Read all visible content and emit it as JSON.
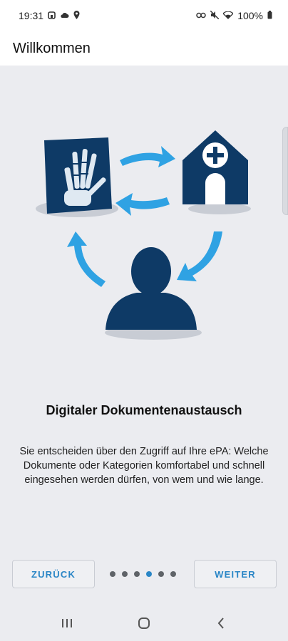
{
  "status_bar": {
    "time": "19:31",
    "battery": "100%",
    "icons_left": [
      "app-notification-icon",
      "cloud-icon",
      "location-icon"
    ],
    "icons_right": [
      "link-icon",
      "mute-icon",
      "wifi-icon",
      "battery-icon"
    ]
  },
  "app_bar": {
    "title": "Willkommen"
  },
  "onboarding": {
    "title": "Digitaler Dokumentenaustausch",
    "description": "Sie entscheiden über den Zugriff auf Ihre ePA: Welche Dokumente oder Kategorien komfortabel und schnell eingesehen werden dürfen, von wem und wie lange.",
    "illustration_icons": [
      "xray-hand-icon",
      "hospital-icon",
      "person-icon",
      "cycle-arrows-icon"
    ],
    "page_count": 6,
    "active_page": 4
  },
  "buttons": {
    "back_label": "ZURÜCK",
    "next_label": "WEITER"
  },
  "nav_bar": {
    "icons": [
      "recent-apps-icon",
      "home-icon",
      "back-icon"
    ]
  },
  "colors": {
    "accent": "#2a86c6",
    "dark_blue": "#0e3a66",
    "arrow_blue": "#2fa2e3",
    "background": "#ebecf0"
  }
}
